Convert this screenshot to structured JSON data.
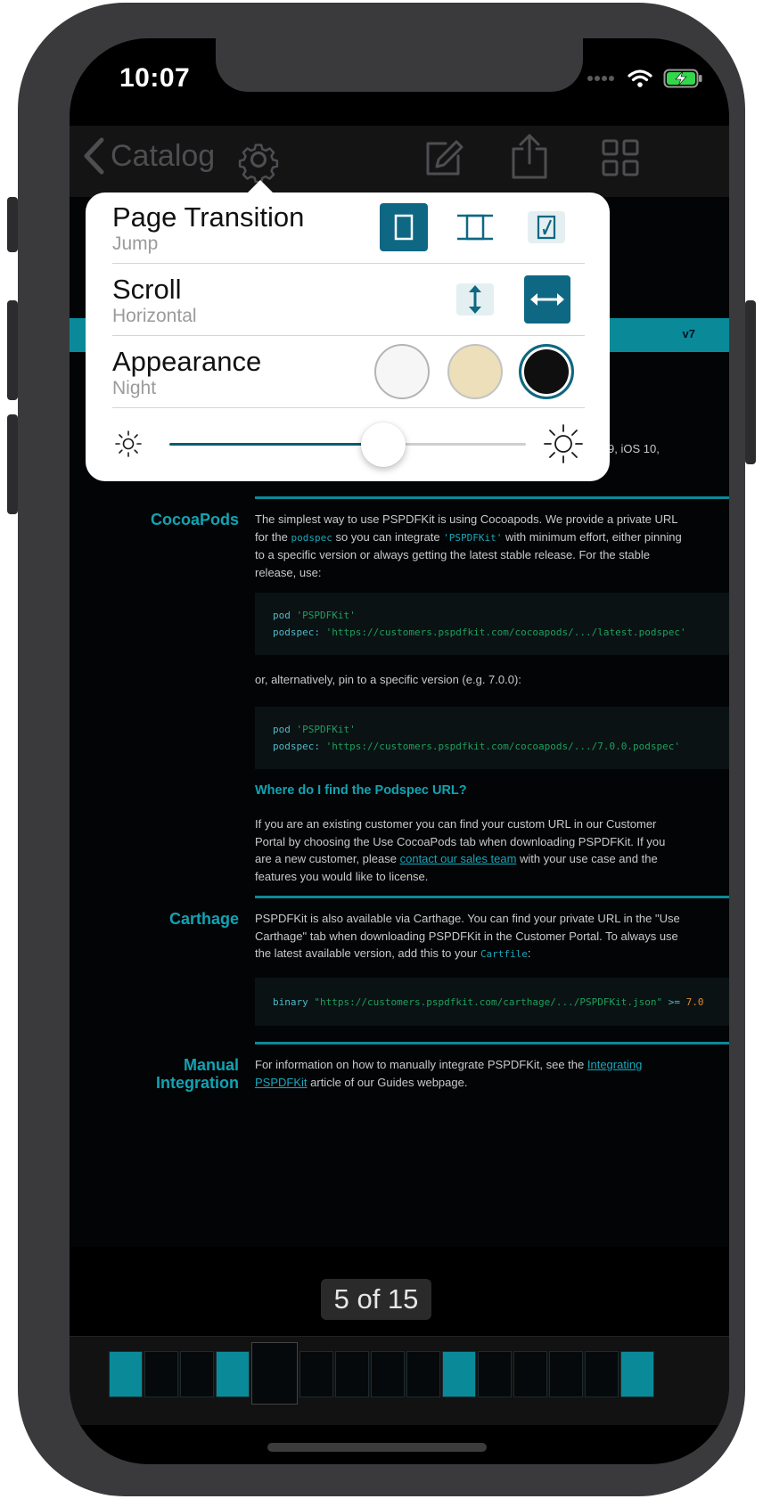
{
  "status": {
    "time": "10:07"
  },
  "nav": {
    "back_label": "Catalog"
  },
  "popover": {
    "transition": {
      "title": "Page Transition",
      "value": "Jump"
    },
    "scroll": {
      "title": "Scroll",
      "value": "Horizontal"
    },
    "appearance": {
      "title": "Appearance",
      "value": "Night"
    },
    "appearance_colors": [
      "#f6f6f6",
      "#ecdfb9",
      "#0f0f0f"
    ],
    "brightness": 0.6
  },
  "doc": {
    "version": "v7",
    "partial_line": "9, iOS 10,",
    "cocoapods_title": "CocoaPods",
    "cocoapods_p1_a": "The simplest way to use PSPDFKit is using Cocoapods. We provide a private URL for the",
    "cocoapods_p1_code1": "podspec",
    "cocoapods_p1_b": "so you can integrate",
    "cocoapods_p1_code2": "'PSPDFKit'",
    "cocoapods_p1_c": "with minimum effort, either pinning to a specific version or always getting the latest stable release. For the stable release, use:",
    "code1_line1_kw": "pod",
    "code1_line1_str": "'PSPDFKit'",
    "code1_line2_kw": "podspec:",
    "code1_line2_str": "'https://customers.pspdfkit.com/cocoapods/.../latest.podspec'",
    "alt_text": "or, alternatively, pin to a specific version (e.g. 7.0.0):",
    "code2_line1_kw": "pod",
    "code2_line1_str": "'PSPDFKit'",
    "code2_line2_kw": "podspec:",
    "code2_line2_str": "'https://customers.pspdfkit.com/cocoapods/.../7.0.0.podspec'",
    "where_heading": "Where do I find the Podspec URL?",
    "where_p_a": "If you are an existing customer you can find your custom URL in our Customer Portal by choosing the Use CocoaPods tab when downloading PSPDFKit. If you are a new customer, please",
    "where_p_link": "contact our sales team",
    "where_p_b": "with your use case and the features you would like to license.",
    "carthage_title": "Carthage",
    "carthage_p_a": "PSPDFKit is also available via Carthage. You can find your private URL in the \"Use Carthage\" tab when downloading PSPDFKit in the Customer Portal. To always use the latest available version, add this to your",
    "carthage_p_code": "Cartfile",
    "carthage_p_b": ":",
    "code3_kw": "binary",
    "code3_str": "\"https://customers.pspdfkit.com/carthage/.../PSPDFKit.json\"",
    "code3_op": ">=",
    "code3_num": "7.0",
    "manual_title_1": "Manual",
    "manual_title_2": "Integration",
    "manual_p_a": "For information on how to manually integrate PSPDFKit, see the",
    "manual_p_link": "Integrating PSPDFKit",
    "manual_p_b": "article of our Guides webpage."
  },
  "page_indicator": "5 of 15",
  "thumbnails": {
    "count": 15,
    "selected_index": 5
  }
}
